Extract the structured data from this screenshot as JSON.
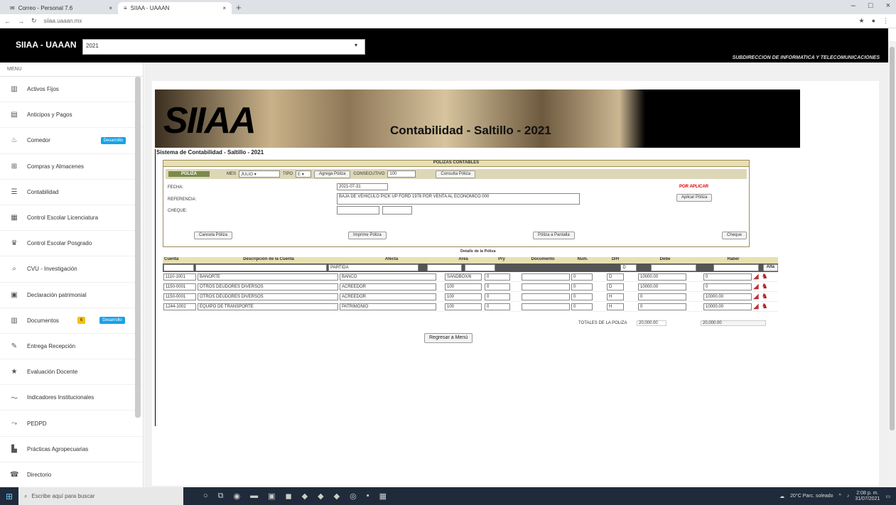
{
  "browser": {
    "tabs": [
      {
        "title": "Correo - Personal 7.6",
        "close": "×"
      },
      {
        "title": "SIIAA - UAAAN",
        "close": "×"
      }
    ],
    "new_tab": "+",
    "window_controls": [
      "–",
      "□",
      "×"
    ],
    "nav": [
      "←",
      "→",
      "↻"
    ],
    "url": "siiaa.uaaan.mx"
  },
  "header": {
    "brand": "SIIAA - UAAAN",
    "selector_value": "2021",
    "subtitle": "SUBDIRECCION DE INFORMATICA Y TELECOMUNICACIONES"
  },
  "sidebar": {
    "title": "MENU",
    "items": [
      {
        "label": "Activos Fijos",
        "icon": "building-icon"
      },
      {
        "label": "Anticipos y Pagos",
        "icon": "calendar-icon"
      },
      {
        "label": "Comedor",
        "icon": "food-icon",
        "badge": "Desarrollo"
      },
      {
        "label": "Compras y Almacenes",
        "icon": "cart-icon"
      },
      {
        "label": "Contabilidad",
        "icon": "ledger-icon"
      },
      {
        "label": "Control Escolar Licenciatura",
        "icon": "id-card-icon"
      },
      {
        "label": "Control Escolar Posgrado",
        "icon": "graduation-icon"
      },
      {
        "label": "CVU - Investigación",
        "icon": "search-icon"
      },
      {
        "label": "Declaración patrimonial",
        "icon": "document-icon"
      },
      {
        "label": "Documentos",
        "icon": "folder-icon",
        "badge_yellow": "6",
        "badge": "Desarrollo"
      },
      {
        "label": "Entrega Recepción",
        "icon": "handshake-icon"
      },
      {
        "label": "Evaluación Docente",
        "icon": "star-icon"
      },
      {
        "label": "Indicadores Institucionales",
        "icon": "chart-line-icon"
      },
      {
        "label": "PEDPD",
        "icon": "trend-icon"
      },
      {
        "label": "Prácticas Agropecuarias",
        "icon": "tractor-icon"
      },
      {
        "label": "Directorio",
        "icon": "phone-icon"
      }
    ]
  },
  "banner": {
    "logo": "SIIAA",
    "title": "Contabilidad - Saltillo - 2021"
  },
  "system_title": "Sistema de Contabilidad - Saltillo - 2021",
  "poliza": {
    "header": "POLIZAS CONTABLES",
    "tab_label": "POLIZA",
    "mes_label": "MES",
    "mes_value": "JULIO",
    "tipo_label": "TIPO",
    "tipo_value": "E",
    "agregar_button": "Agrega Póliza",
    "consecutivo_label": "CONSECUTIVO",
    "consecutivo_value": "100",
    "consultar_button": "Consulta Póliza",
    "fecha_label": "FECHA:",
    "fecha_value": "2021-07-31",
    "referencia_label": "REFERENCIA:",
    "referencia_value": "BAJA DE VEHICULO PICK UP FORD 1978 POR VENTA AL ECONOMICO 000",
    "cheque_label": "CHEQUE:",
    "status": "POR APLICAR",
    "aplicar_button": "Aplicar Póliza",
    "bottom_buttons": [
      "Cancela Póliza",
      "Imprime Póliza",
      "Póliza a Pantalla",
      "Cheque"
    ],
    "detail_caption": "Detalle de la Póliza"
  },
  "grid": {
    "columns": [
      "Cuenta",
      "Descripción de la Cuenta",
      "Afecta",
      "Área",
      "Pry",
      "Documento",
      "Num.",
      "D/H",
      "Debe",
      "Haber"
    ],
    "filter_afecta": "PARTIDA",
    "filter_dh": "D",
    "alta_button": "Alta",
    "rows": [
      {
        "cuenta": "1110-1001",
        "descripcion": "BANORTE",
        "afecta": "BANCO",
        "area": "SANDBOX/6",
        "pry": "0",
        "documento": "",
        "num": "0",
        "dh": "D",
        "debe": "10000.00",
        "haber": "0"
      },
      {
        "cuenta": "1150-0001",
        "descripcion": "OTROS DEUDORES DIVERSOS",
        "afecta": "ACREEDOR",
        "area": "100",
        "pry": "0",
        "documento": "",
        "num": "0",
        "dh": "D",
        "debe": "10000.00",
        "haber": "0"
      },
      {
        "cuenta": "1150-0001",
        "descripcion": "OTROS DEUDORES DIVERSOS",
        "afecta": "ACREEDOR",
        "area": "100",
        "pry": "0",
        "documento": "",
        "num": "0",
        "dh": "H",
        "debe": "0",
        "haber": "10000.00"
      },
      {
        "cuenta": "1244-1002",
        "descripcion": "EQUIPO DE TRANSPORTE",
        "afecta": "PATRIMONIO",
        "area": "100",
        "pry": "0",
        "documento": "",
        "num": "0",
        "dh": "H",
        "debe": "0",
        "haber": "10000.00"
      }
    ],
    "totals_label": "TOTALES DE LA POLIZA",
    "total_debe": "20,000.00",
    "total_haber": "20,000.00"
  },
  "regresar_button": "Regresar a Menú",
  "taskbar": {
    "search_placeholder": "Escribe aquí para buscar",
    "weather": "20°C Parc. soleado",
    "time": "2:08 p. m.",
    "date": "31/07/2021"
  }
}
